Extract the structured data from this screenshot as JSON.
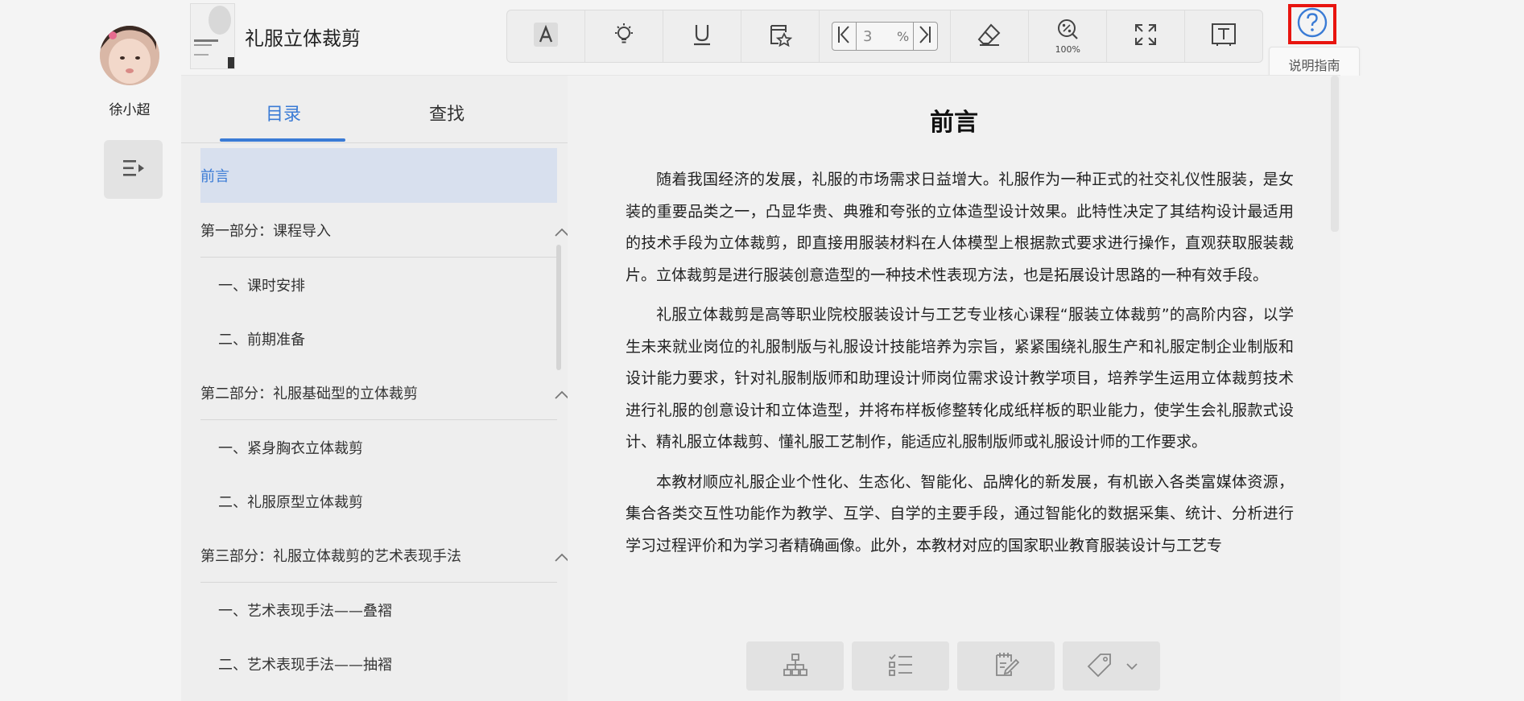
{
  "user": {
    "name": "徐小超"
  },
  "book": {
    "title": "礼服立体裁剪"
  },
  "toolbar": {
    "page_value": "3",
    "page_unit": "%",
    "zoom_label": "100%"
  },
  "help": {
    "tooltip": "说明指南"
  },
  "tabs": {
    "toc": "目录",
    "search": "查找"
  },
  "toc": {
    "items": [
      {
        "label": "前言"
      },
      {
        "label": "第一部分：课程导入"
      },
      {
        "label": "一、课时安排"
      },
      {
        "label": "二、前期准备"
      },
      {
        "label": "第二部分：礼服基础型的立体裁剪"
      },
      {
        "label": "一、紧身胸衣立体裁剪"
      },
      {
        "label": "二、礼服原型立体裁剪"
      },
      {
        "label": "第三部分：礼服立体裁剪的艺术表现手法"
      },
      {
        "label": "一、艺术表现手法——叠褶"
      },
      {
        "label": "二、艺术表现手法——抽褶"
      }
    ]
  },
  "document": {
    "title": "前言",
    "paragraphs": [
      "随着我国经济的发展，礼服的市场需求日益增大。礼服作为一种正式的社交礼仪性服装，是女装的重要品类之一，凸显华贵、典雅和夸张的立体造型设计效果。此特性决定了其结构设计最适用的技术手段为立体裁剪，即直接用服装材料在人体模型上根据款式要求进行操作，直观获取服装裁片。立体裁剪是进行服装创意造型的一种技术性表现方法，也是拓展设计思路的一种有效手段。",
      "礼服立体裁剪是高等职业院校服装设计与工艺专业核心课程“服装立体裁剪”的高阶内容，以学生未来就业岗位的礼服制版与礼服设计技能培养为宗旨，紧紧围绕礼服生产和礼服定制企业制版和设计能力要求，针对礼服制版师和助理设计师岗位需求设计教学项目，培养学生运用立体裁剪技术进行礼服的创意设计和立体造型，并将布样板修整转化成纸样板的职业能力，使学生会礼服款式设计、精礼服立体裁剪、懂礼服工艺制作，能适应礼服制版师或礼服设计师的工作要求。",
      "本教材顺应礼服企业个性化、生态化、智能化、品牌化的新发展，有机嵌入各类富媒体资源，集合各类交互性功能作为教学、互学、自学的主要手段，通过智能化的数据采集、统计、分析进行学习过程评价和为学习者精确画像。此外，本教材对应的国家职业教育服装设计与工艺专"
    ]
  },
  "colors": {
    "accent": "#3a7bd5",
    "highlight": "#e8140f",
    "active_bg": "#d8e0ee"
  }
}
